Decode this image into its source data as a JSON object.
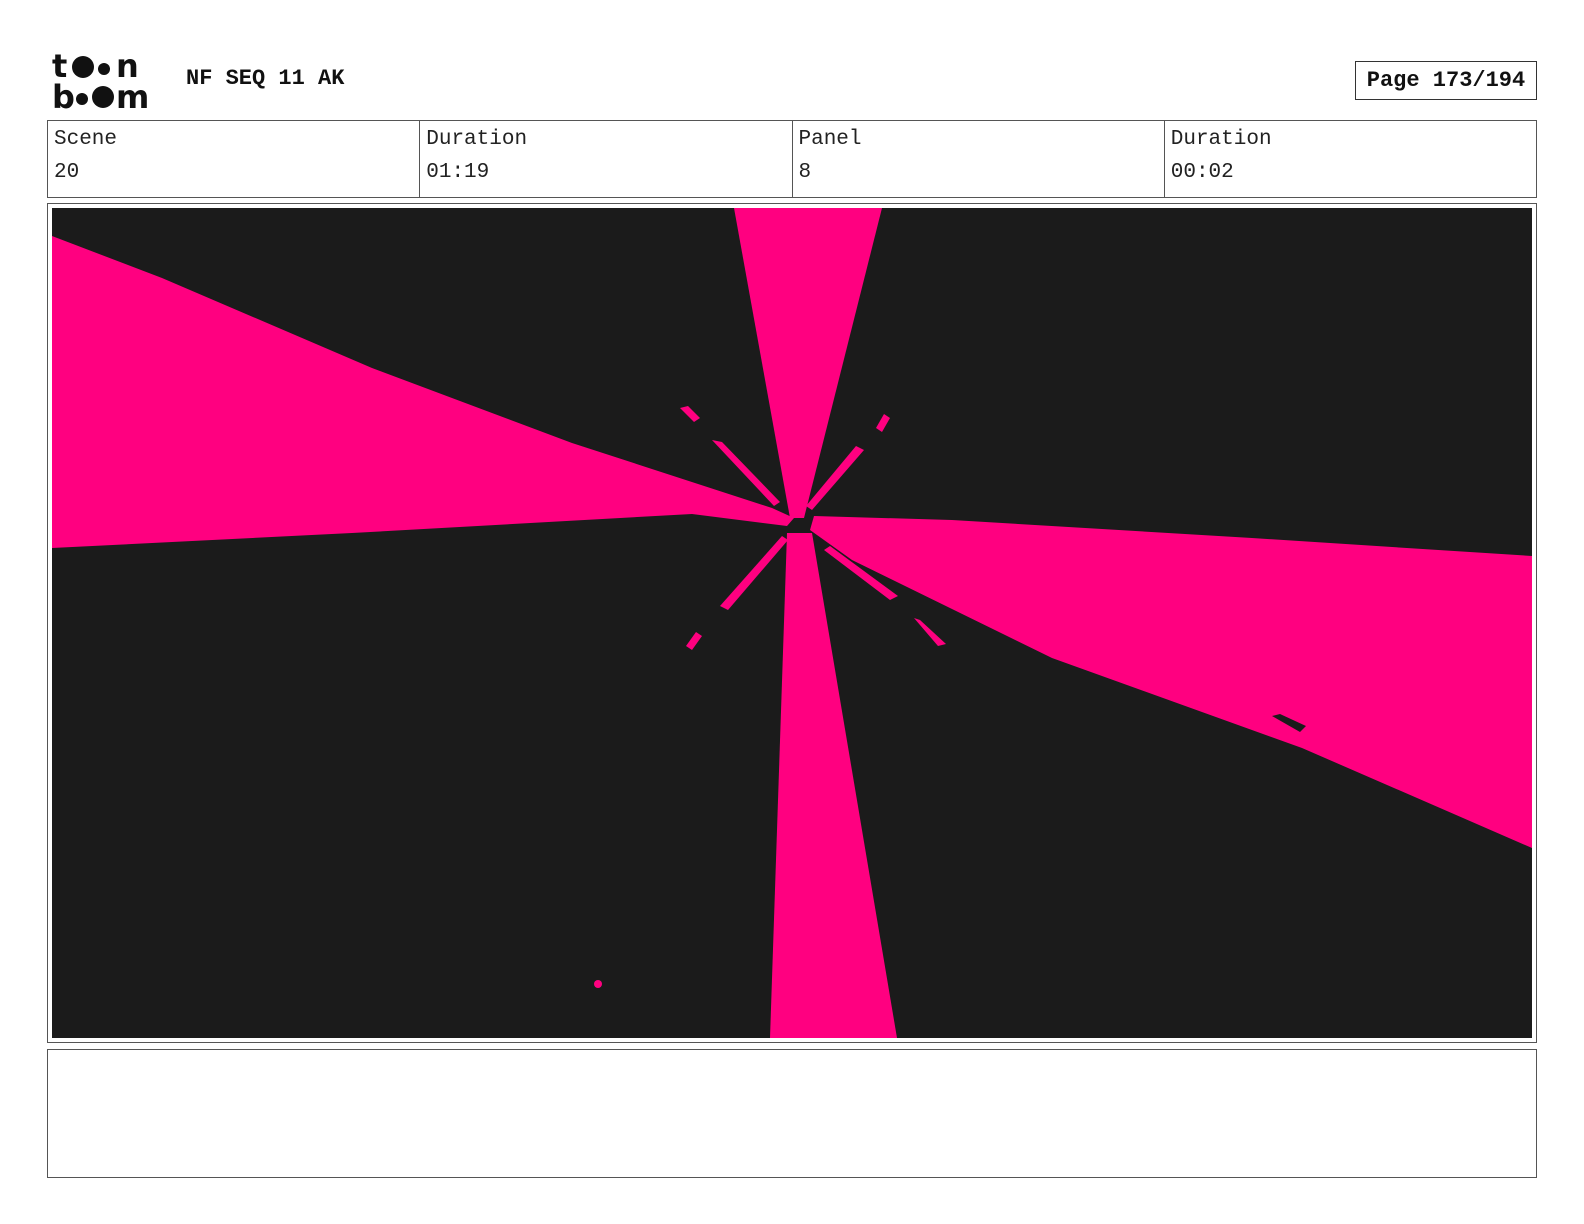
{
  "header": {
    "logo_top": "toon",
    "logo_bottom": "boom",
    "sequence_title": "NF SEQ 11 AK",
    "page_label": "Page 173/194"
  },
  "info": [
    {
      "label": "Scene",
      "value": "20"
    },
    {
      "label": "Duration",
      "value": "01:19"
    },
    {
      "label": "Panel",
      "value": "8"
    },
    {
      "label": "Duration",
      "value": "00:02"
    }
  ],
  "panel": {
    "background_color": "#1b1b1b",
    "ray_color": "#ff0080"
  },
  "notes": {
    "text": ""
  }
}
